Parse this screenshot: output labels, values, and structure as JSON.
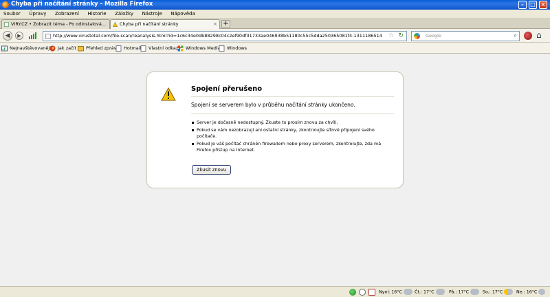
{
  "window": {
    "title": "Chyba při načítání stránky - Mozilla Firefox",
    "minimize_icon": "minimize-icon",
    "maximize_icon": "maximize-icon",
    "close_icon": "close-icon"
  },
  "menu": [
    "Soubor",
    "Úpravy",
    "Zobrazení",
    "Historie",
    "Záložky",
    "Nástroje",
    "Nápověda"
  ],
  "tabs": [
    {
      "label": "VIRY.CZ • Zobrazit téma - Po odinstalová...",
      "active": false
    },
    {
      "label": "Chyba při načítání stránky",
      "active": true
    }
  ],
  "nav": {
    "url": "http://www.virustotal.com/file-scan/reanalysis.html?id=1c6c34e0db88298c04c2ef90df31733ae046938b51180c55c5dda250365081f4-1311186514",
    "search_placeholder": "Google"
  },
  "bookmarks": [
    "Nejnavštěvovanější",
    "Jak začít",
    "Přehled zpráv",
    "Hotmail",
    "Vlastní odkazy",
    "Windows Media",
    "Windows"
  ],
  "error": {
    "title": "Spojení přerušeno",
    "description": "Spojení se serverem bylo v průběhu načítání stránky ukončeno.",
    "items": [
      "Server je dočasně nedostupný. Zkuste to prosím znovu za chvíli.",
      "Pokud se vám nezobrazují ani ostatní stránky, zkontrolujte síťové připojení svého počítače.",
      "Pokud je váš počítač chráněn firewallem nebo proxy serverem, zkontrolujte, zda má Firefox přístup na Internet."
    ],
    "retry_label": "Zkusit znovu"
  },
  "statusbar": {
    "weather": [
      "Nyní: 16°C",
      "Čt.: 17°C",
      "Pá.: 17°C",
      "So.: 17°C",
      "Ne.: 16°C"
    ]
  },
  "colors": {
    "titlebar": "#0a5fd8",
    "warning": "#f5c400"
  }
}
